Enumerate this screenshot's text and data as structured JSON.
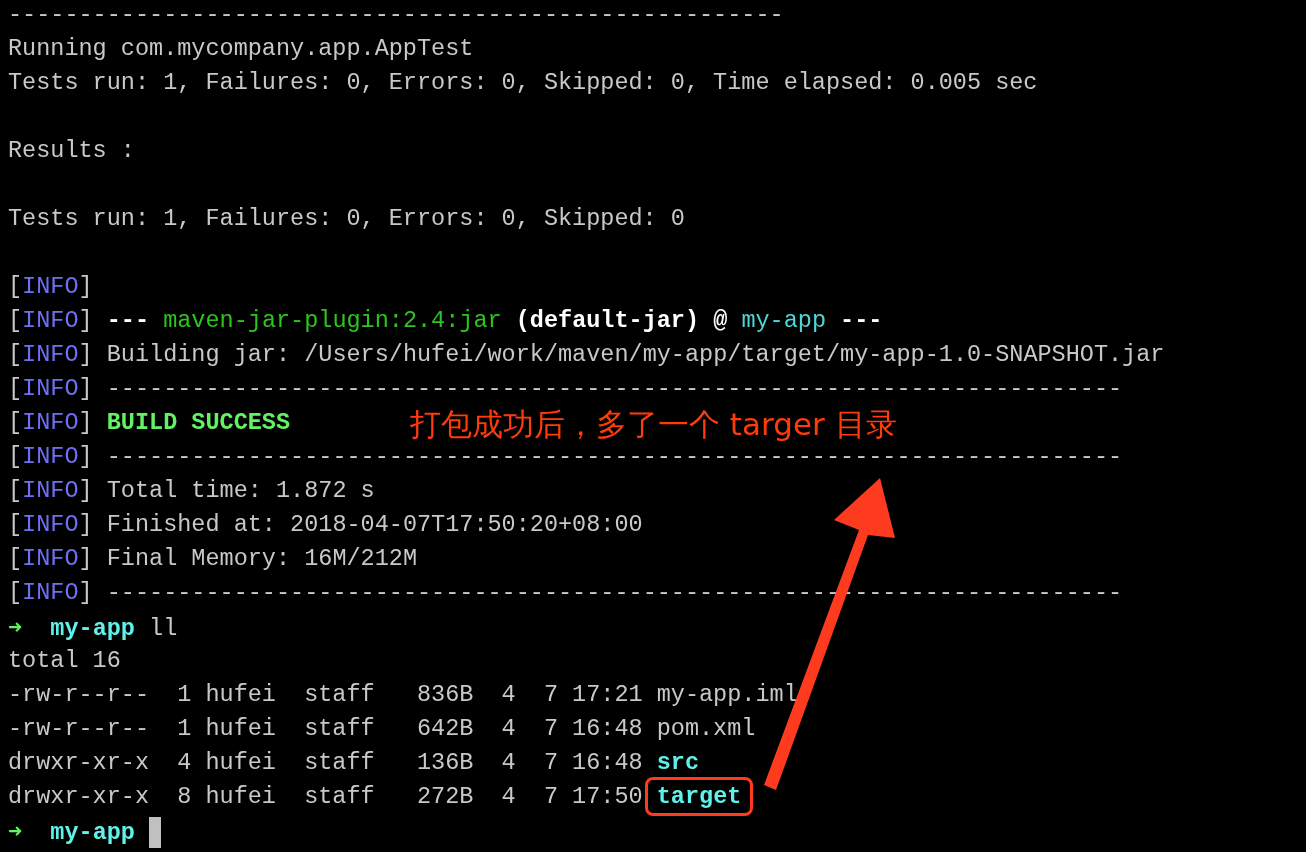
{
  "terminal": {
    "lines": [
      {
        "kind": "text",
        "segments": [
          {
            "text": "-------------------------------------------------------",
            "kind": "plain"
          }
        ]
      },
      {
        "kind": "text",
        "segments": [
          {
            "text": "Running com.mycompany.app.AppTest",
            "kind": "plain"
          }
        ]
      },
      {
        "kind": "text",
        "segments": [
          {
            "text": "Tests run: 1, Failures: 0, Errors: 0, Skipped: 0, Time elapsed: 0.005 sec",
            "kind": "plain"
          }
        ]
      },
      {
        "kind": "blank"
      },
      {
        "kind": "text",
        "segments": [
          {
            "text": "Results :",
            "kind": "plain"
          }
        ]
      },
      {
        "kind": "blank"
      },
      {
        "kind": "text",
        "segments": [
          {
            "text": "Tests run: 1, Failures: 0, Errors: 0, Skipped: 0",
            "kind": "plain"
          }
        ]
      },
      {
        "kind": "blank"
      },
      {
        "kind": "text",
        "segments": [
          {
            "text": "[",
            "kind": "plain"
          },
          {
            "text": "INFO",
            "kind": "info"
          },
          {
            "text": "]",
            "kind": "plain"
          }
        ]
      },
      {
        "kind": "text",
        "segments": [
          {
            "text": "[",
            "kind": "plain"
          },
          {
            "text": "INFO",
            "kind": "info"
          },
          {
            "text": "]",
            "kind": "plain"
          },
          {
            "text": " ---",
            "kind": "bold"
          },
          {
            "text": " maven-jar-plugin:2.4:jar",
            "kind": "plugin"
          },
          {
            "text": " (default-jar)",
            "kind": "bold"
          },
          {
            "text": " @",
            "kind": "bold"
          },
          {
            "text": " my-app",
            "kind": "project"
          },
          {
            "text": " ---",
            "kind": "bold"
          }
        ]
      },
      {
        "kind": "text",
        "segments": [
          {
            "text": "[",
            "kind": "plain"
          },
          {
            "text": "INFO",
            "kind": "info"
          },
          {
            "text": "]",
            "kind": "plain"
          },
          {
            "text": " Building jar: /Users/hufei/work/maven/my-app/target/my-app-1.0-SNAPSHOT.jar",
            "kind": "plain"
          }
        ]
      },
      {
        "kind": "text",
        "segments": [
          {
            "text": "[",
            "kind": "plain"
          },
          {
            "text": "INFO",
            "kind": "info"
          },
          {
            "text": "]",
            "kind": "plain"
          },
          {
            "text": " ------------------------------------------------------------------------",
            "kind": "plain"
          }
        ]
      },
      {
        "kind": "text",
        "segments": [
          {
            "text": "[",
            "kind": "plain"
          },
          {
            "text": "INFO",
            "kind": "info"
          },
          {
            "text": "]",
            "kind": "plain"
          },
          {
            "text": " BUILD SUCCESS",
            "kind": "success"
          }
        ]
      },
      {
        "kind": "text",
        "segments": [
          {
            "text": "[",
            "kind": "plain"
          },
          {
            "text": "INFO",
            "kind": "info"
          },
          {
            "text": "]",
            "kind": "plain"
          },
          {
            "text": " ------------------------------------------------------------------------",
            "kind": "plain"
          }
        ]
      },
      {
        "kind": "text",
        "segments": [
          {
            "text": "[",
            "kind": "plain"
          },
          {
            "text": "INFO",
            "kind": "info"
          },
          {
            "text": "]",
            "kind": "plain"
          },
          {
            "text": " Total time: 1.872 s",
            "kind": "plain"
          }
        ]
      },
      {
        "kind": "text",
        "segments": [
          {
            "text": "[",
            "kind": "plain"
          },
          {
            "text": "INFO",
            "kind": "info"
          },
          {
            "text": "]",
            "kind": "plain"
          },
          {
            "text": " Finished at: 2018-04-07T17:50:20+08:00",
            "kind": "plain"
          }
        ]
      },
      {
        "kind": "text",
        "segments": [
          {
            "text": "[",
            "kind": "plain"
          },
          {
            "text": "INFO",
            "kind": "info"
          },
          {
            "text": "]",
            "kind": "plain"
          },
          {
            "text": " Final Memory: 16M/212M",
            "kind": "plain"
          }
        ]
      },
      {
        "kind": "text",
        "segments": [
          {
            "text": "[",
            "kind": "plain"
          },
          {
            "text": "INFO",
            "kind": "info"
          },
          {
            "text": "]",
            "kind": "plain"
          },
          {
            "text": " ------------------------------------------------------------------------",
            "kind": "plain"
          }
        ]
      },
      {
        "kind": "text",
        "segments": [
          {
            "text": "➜",
            "kind": "arrow"
          },
          {
            "text": "  my-app",
            "kind": "dir"
          },
          {
            "text": " ll",
            "kind": "plain"
          }
        ]
      },
      {
        "kind": "text",
        "segments": [
          {
            "text": "total 16",
            "kind": "plain"
          }
        ]
      },
      {
        "kind": "text",
        "segments": [
          {
            "text": "-rw-r--r--  1 hufei  staff   836B  4  7 17:21 my-app.iml",
            "kind": "plain"
          }
        ]
      },
      {
        "kind": "text",
        "segments": [
          {
            "text": "-rw-r--r--  1 hufei  staff   642B  4  7 16:48 pom.xml",
            "kind": "plain"
          }
        ]
      },
      {
        "kind": "text",
        "segments": [
          {
            "text": "drwxr-xr-x  4 hufei  staff   136B  4  7 16:48 ",
            "kind": "plain"
          },
          {
            "text": "src",
            "kind": "dir"
          }
        ]
      },
      {
        "kind": "text",
        "segments": [
          {
            "text": "drwxr-xr-x  8 hufei  staff   272B  4  7 17:50 ",
            "kind": "plain"
          },
          {
            "text": "target",
            "kind": "dir",
            "highlighted": true
          }
        ]
      },
      {
        "kind": "text",
        "segments": [
          {
            "text": "➜",
            "kind": "arrow"
          },
          {
            "text": "  my-app",
            "kind": "dir"
          }
        ],
        "cursor": true
      }
    ]
  },
  "annotation": {
    "text": "打包成功后，多了一个 targer 目录"
  }
}
